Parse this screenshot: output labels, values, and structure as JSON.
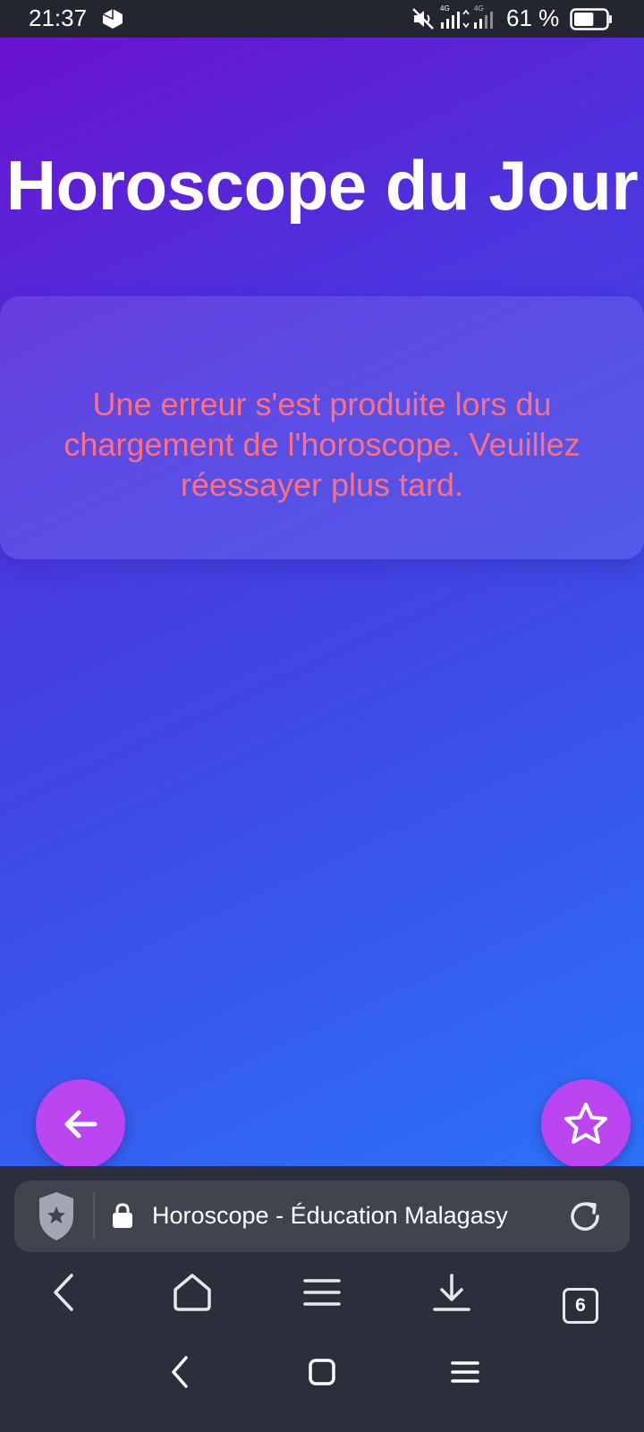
{
  "status_bar": {
    "time": "21:37",
    "network_1": "4G",
    "network_2": "4G",
    "battery_text": "61 %",
    "battery_level": 0.61
  },
  "app": {
    "title": "Horoscope du Jour",
    "error_message": "Une erreur s'est produite lors du chargement de l'horoscope. Veuillez réessayer plus tard.",
    "back_icon": "arrow-left-icon",
    "favorite_icon": "star-icon"
  },
  "browser": {
    "page_title": "Horoscope - Éducation Malagasy",
    "tabs_count": "6",
    "icons": [
      "shield-icon",
      "lock-icon",
      "reload-icon",
      "back-icon",
      "home-icon",
      "menu-icon",
      "download-icon",
      "tabs-icon"
    ]
  },
  "colors": {
    "gradient_start": "#6a11cf",
    "gradient_end": "#2b72f8",
    "fab": "#bb45f0",
    "error_text": "#ff6f7f",
    "browser_bg": "#2b2f3b"
  }
}
